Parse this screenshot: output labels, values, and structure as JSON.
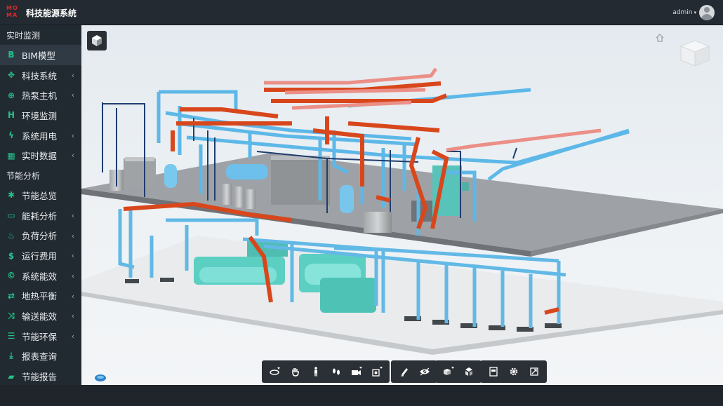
{
  "header": {
    "logo_text_top": "MO",
    "logo_text_bottom": "MA",
    "title": "科技能源系统",
    "username": "admin",
    "user_caret": "▾"
  },
  "sidebar": {
    "section1_title": "实时监测",
    "section2_title": "节能分析",
    "items": [
      {
        "label": "BIM模型",
        "icon": "B",
        "chevron": ""
      },
      {
        "label": "科技系统",
        "icon": "✥",
        "chevron": "‹"
      },
      {
        "label": "热泵主机",
        "icon": "⊕",
        "chevron": "‹"
      },
      {
        "label": "环境监测",
        "icon": "H",
        "chevron": ""
      },
      {
        "label": "系统用电",
        "icon": "ϟ",
        "chevron": "‹"
      },
      {
        "label": "实时数据",
        "icon": "▦",
        "chevron": "‹"
      },
      {
        "label": "节能总览",
        "icon": "✱",
        "chevron": ""
      },
      {
        "label": "能耗分析",
        "icon": "▭",
        "chevron": "‹"
      },
      {
        "label": "负荷分析",
        "icon": "♨",
        "chevron": "‹"
      },
      {
        "label": "运行费用",
        "icon": "$",
        "chevron": "‹"
      },
      {
        "label": "系统能效",
        "icon": "©",
        "chevron": "‹"
      },
      {
        "label": "地热平衡",
        "icon": "⇄",
        "chevron": "‹"
      },
      {
        "label": "输送能效",
        "icon": "⤨",
        "chevron": "‹"
      },
      {
        "label": "节能环保",
        "icon": "☰",
        "chevron": "‹"
      },
      {
        "label": "报表查询",
        "icon": "⤓",
        "chevron": ""
      },
      {
        "label": "节能报告",
        "icon": "▰",
        "chevron": ""
      }
    ]
  },
  "viewer": {
    "icons": {
      "cube_button": "3d-cube-icon",
      "home": "home-icon",
      "viewcube": "viewcube-icon"
    },
    "toolbar_groups": [
      [
        "orbit-icon",
        "pan-icon",
        "first-person-icon",
        "walk-icon",
        "camera-icon",
        "section-box-icon"
      ],
      [
        "markup-pen-icon",
        "visibility-eye-icon"
      ],
      [
        "model-browser-icon",
        "explode-icon"
      ],
      [
        "properties-icon",
        "settings-icon",
        "fullscreen-icon"
      ]
    ]
  },
  "colors": {
    "accent_icon": "#21c38a",
    "sidebar_bg": "#222a31",
    "topbar_bg": "#232a31",
    "active_item_bg": "#2f3a44",
    "hot_pipe": "#d2451c",
    "cold_pipe": "#5bb6e6",
    "equipment_teal": "#62d2c6"
  }
}
